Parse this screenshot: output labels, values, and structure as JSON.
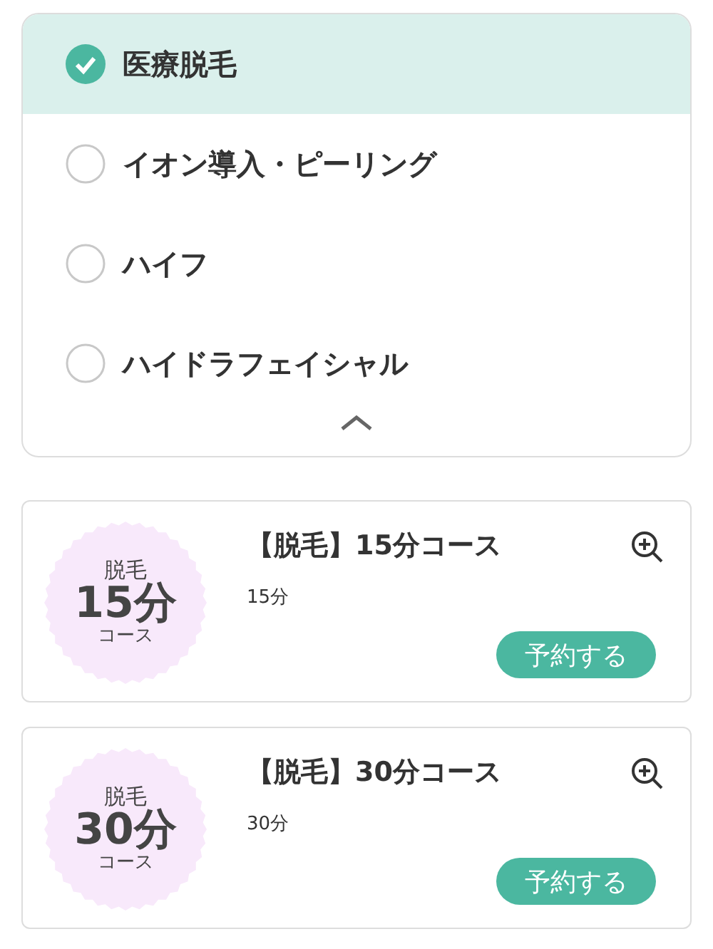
{
  "categories": [
    {
      "label": "医療脱毛",
      "selected": true
    },
    {
      "label": "イオン導入・ピーリング",
      "selected": false
    },
    {
      "label": "ハイフ",
      "selected": false
    },
    {
      "label": "ハイドラフェイシャル",
      "selected": false
    }
  ],
  "courses": [
    {
      "badge_top": "脱毛",
      "badge_main": "15分",
      "badge_bottom": "コース",
      "title": "【脱毛】15分コース",
      "duration": "15分",
      "button": "予約する"
    },
    {
      "badge_top": "脱毛",
      "badge_main": "30分",
      "badge_bottom": "コース",
      "title": "【脱毛】30分コース",
      "duration": "30分",
      "button": "予約する"
    }
  ]
}
